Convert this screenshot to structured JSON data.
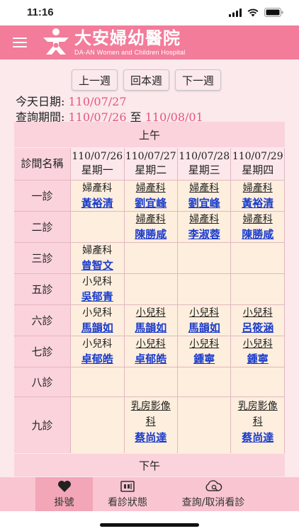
{
  "status": {
    "time": "11:16"
  },
  "hospital": {
    "name_cn": "大安婦幼醫院",
    "name_en": "DA-AN Women and Children Hospital"
  },
  "week_nav": {
    "prev": "上一週",
    "current": "回本週",
    "next": "下一週"
  },
  "today": {
    "label": "今天日期:",
    "value": "110/07/27"
  },
  "period": {
    "label": "查詢期間:",
    "start": "110/07/26",
    "sep": "至",
    "end": "110/08/01"
  },
  "schedule": {
    "am_label": "上午",
    "pm_label": "下午",
    "room_col_label": "診間名稱",
    "days": [
      {
        "date": "110/07/26",
        "weekday": "星期一"
      },
      {
        "date": "110/07/27",
        "weekday": "星期二"
      },
      {
        "date": "110/07/28",
        "weekday": "星期三"
      },
      {
        "date": "110/07/29",
        "weekday": "星期四"
      }
    ],
    "rooms": [
      {
        "name": "一診",
        "slots": [
          {
            "dept": "婦產科",
            "doctor": "黃裕清"
          },
          {
            "dept": "婦產科",
            "doctor": "劉宜峰"
          },
          {
            "dept": "婦產科",
            "doctor": "劉宜峰"
          },
          {
            "dept": "婦產科",
            "doctor": "黃裕清"
          }
        ]
      },
      {
        "name": "二診",
        "slots": [
          null,
          {
            "dept": "婦產科",
            "doctor": "陳勝咸"
          },
          {
            "dept": "婦產科",
            "doctor": "李淑蓉"
          },
          {
            "dept": "婦產科",
            "doctor": "陳勝咸"
          }
        ]
      },
      {
        "name": "三診",
        "slots": [
          {
            "dept": "婦產科",
            "doctor": "曾智文"
          },
          null,
          null,
          null
        ]
      },
      {
        "name": "五診",
        "slots": [
          {
            "dept": "小兒科",
            "doctor": "吳郁青"
          },
          null,
          null,
          null
        ]
      },
      {
        "name": "六診",
        "slots": [
          {
            "dept": "小兒科",
            "doctor": "馬韻如"
          },
          {
            "dept": "小兒科",
            "doctor": "馬韻如"
          },
          {
            "dept": "小兒科",
            "doctor": "馬韻如"
          },
          {
            "dept": "小兒科",
            "doctor": "呂筱涵"
          }
        ]
      },
      {
        "name": "七診",
        "slots": [
          {
            "dept": "小兒科",
            "doctor": "卓郁皓"
          },
          {
            "dept": "小兒科",
            "doctor": "卓郁皓"
          },
          {
            "dept": "小兒科",
            "doctor": "鍾寧"
          },
          {
            "dept": "小兒科",
            "doctor": "鍾寧"
          }
        ]
      },
      {
        "name": "八診",
        "slots": [
          null,
          null,
          null,
          null
        ]
      },
      {
        "name": "九診",
        "slots": [
          null,
          {
            "dept": "乳房影像科",
            "doctor": "蔡尚達"
          },
          null,
          {
            "dept": "乳房影像科",
            "doctor": "蔡尚達"
          }
        ]
      }
    ]
  },
  "tabs": [
    {
      "label": "掛號",
      "icon": "heart-icon",
      "active": true
    },
    {
      "label": "看診狀態",
      "icon": "monitor-icon",
      "active": false
    },
    {
      "label": "查詢/取消看診",
      "icon": "cloud-search-icon",
      "active": false
    }
  ],
  "colors": {
    "brand": "#f37c9b",
    "background": "#fbe9ec",
    "accent_text": "#e7547f",
    "doctor_link": "#1a3ccc"
  }
}
